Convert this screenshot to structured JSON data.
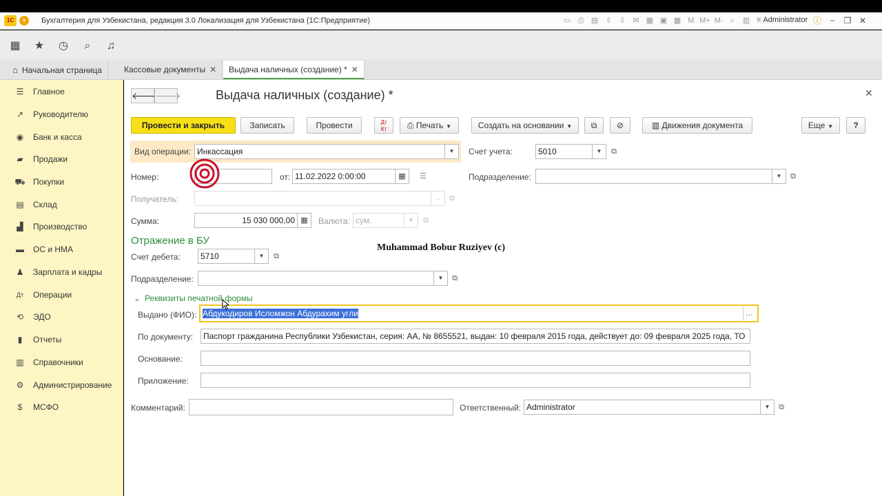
{
  "window": {
    "title": "Бухгалтерия для Узбекистана, редакция 3.0 Локализация для Узбекистана  (1С:Предприятие)",
    "user": "Administrator",
    "logo_text": "1С"
  },
  "tabs": [
    {
      "label": "Начальная страница"
    },
    {
      "label": "Кассовые документы"
    },
    {
      "label": "Выдача наличных (создание) *"
    }
  ],
  "sidebar": {
    "items": [
      {
        "label": "Главное",
        "icon": "menu-icon"
      },
      {
        "label": "Руководителю",
        "icon": "chart-line-icon"
      },
      {
        "label": "Банк и касса",
        "icon": "cash-icon"
      },
      {
        "label": "Продажи",
        "icon": "bag-icon"
      },
      {
        "label": "Покупки",
        "icon": "cart-icon"
      },
      {
        "label": "Склад",
        "icon": "warehouse-icon"
      },
      {
        "label": "Производство",
        "icon": "factory-icon"
      },
      {
        "label": "ОС и НМА",
        "icon": "assets-icon"
      },
      {
        "label": "Зарплата и кадры",
        "icon": "people-icon"
      },
      {
        "label": "Операции",
        "icon": "operations-icon"
      },
      {
        "label": "ЭДО",
        "icon": "edo-icon"
      },
      {
        "label": "Отчеты",
        "icon": "report-icon"
      },
      {
        "label": "Справочники",
        "icon": "book-icon"
      },
      {
        "label": "Администрирование",
        "icon": "gear-icon"
      },
      {
        "label": "МСФО",
        "icon": "ifrs-icon"
      }
    ]
  },
  "form": {
    "title": "Выдача наличных (создание) *",
    "buttons": {
      "post_close": "Провести и закрыть",
      "save": "Записать",
      "post": "Провести",
      "print": "Печать",
      "create_based": "Создать на основании",
      "movements": "Движения документа",
      "more": "Еще",
      "help": "?"
    },
    "operation_type": {
      "label": "Вид операции:",
      "value": "Инкассация"
    },
    "account": {
      "label": "Счет учета:",
      "value": "5010"
    },
    "number": {
      "label": "Номер:",
      "value": ""
    },
    "date": {
      "label": "от:",
      "value": "11.02.2022  0:00:00"
    },
    "division": {
      "label": "Подразделение:",
      "value": ""
    },
    "recipient": {
      "label": "Получатель:",
      "value": ""
    },
    "amount": {
      "label": "Сумма:",
      "value": "15 030 000,00"
    },
    "currency": {
      "label": "Валюта:",
      "value": "сум."
    },
    "section_bu": "Отражение в БУ",
    "debit_account": {
      "label": "Счет дебета:",
      "value": "5710"
    },
    "bu_division": {
      "label": "Подразделение:",
      "value": ""
    },
    "print_group": "Реквизиты печатной формы",
    "issued_to": {
      "label": "Выдано (ФИО):",
      "value": "Абдукодиров Исломжон Абдурахим угли"
    },
    "by_document": {
      "label": "По документу:",
      "value": "Паспорт гражданина Республики Узбекистан, серия: АА, № 8655521, выдан: 10 февраля 2015 года, действует до: 09 февраля 2025 года, ТО"
    },
    "basis": {
      "label": "Основание:",
      "value": ""
    },
    "attachment": {
      "label": "Приложение:",
      "value": ""
    },
    "comment": {
      "label": "Комментарий:",
      "value": ""
    },
    "responsible": {
      "label": "Ответственный:",
      "value": "Administrator"
    },
    "watermark": "Muhammad Bobur Ruziyev (c)"
  }
}
